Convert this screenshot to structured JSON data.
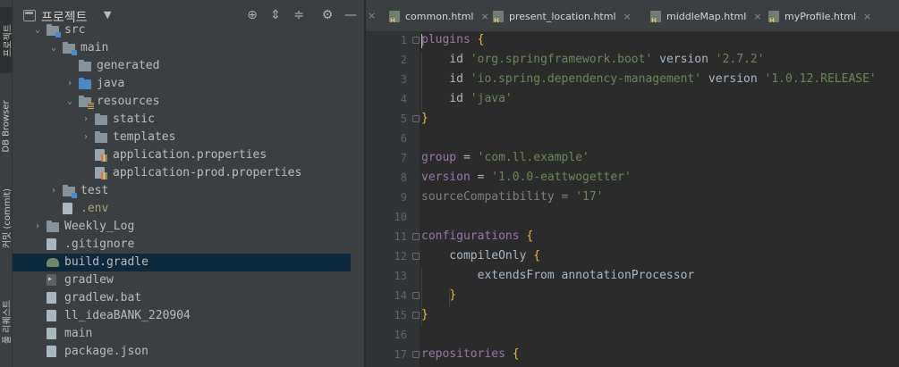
{
  "toolstrip": {
    "items": [
      {
        "label": "프로젝트"
      },
      {
        "label": "DB Browser"
      },
      {
        "label": "커밋 (commit)"
      },
      {
        "label": "풀 리퀘스트"
      }
    ]
  },
  "project_panel": {
    "title": "프로젝트",
    "dropdown": "▼",
    "header_icons": [
      "crosshair-icon",
      "expand-all-icon",
      "collapse-all-icon",
      "gear-icon",
      "minimize-icon"
    ]
  },
  "tree": [
    {
      "label": "src",
      "arrow": "⌄",
      "icon": "folder mod"
    },
    {
      "label": "main",
      "arrow": "⌄",
      "icon": "folder mod"
    },
    {
      "label": "generated",
      "arrow": "",
      "icon": "folder"
    },
    {
      "label": "java",
      "arrow": "›",
      "icon": "folder src"
    },
    {
      "label": "resources",
      "arrow": "⌄",
      "icon": "folder res"
    },
    {
      "label": "static",
      "arrow": "›",
      "icon": "folder"
    },
    {
      "label": "templates",
      "arrow": "›",
      "icon": "folder"
    },
    {
      "label": "application.properties",
      "arrow": "",
      "icon": "file props"
    },
    {
      "label": "application-prod.properties",
      "arrow": "",
      "icon": "file props"
    },
    {
      "label": "test",
      "arrow": "›",
      "icon": "folder mod"
    },
    {
      "label": ".env",
      "arrow": "",
      "icon": "file text",
      "color": "#a8a56f"
    },
    {
      "label": "Weekly_Log",
      "arrow": "›",
      "icon": "folder"
    },
    {
      "label": ".gitignore",
      "arrow": "",
      "icon": "file text"
    },
    {
      "label": "build.gradle",
      "arrow": "",
      "icon": "file gradle",
      "selected": true
    },
    {
      "label": "gradlew",
      "arrow": "",
      "icon": "file term"
    },
    {
      "label": "gradlew.bat",
      "arrow": "",
      "icon": "file text"
    },
    {
      "label": "ll_ideaBANK_220904",
      "arrow": "",
      "icon": "file text"
    },
    {
      "label": "main",
      "arrow": "",
      "icon": "file text"
    },
    {
      "label": "package.json",
      "arrow": "",
      "icon": "file text"
    }
  ],
  "tabs": [
    {
      "label": "common.html",
      "close": "×"
    },
    {
      "label": "present_location.html",
      "close": "×"
    },
    {
      "label": "middleMap.html",
      "close": "×"
    },
    {
      "label": "myProfile.html",
      "close": "×"
    }
  ],
  "tabbar": {
    "scroll_close": "×"
  },
  "editor": {
    "line_numbers": [
      "1",
      "2",
      "3",
      "4",
      "5",
      "6",
      "7",
      "8",
      "9",
      "10",
      "11",
      "12",
      "13",
      "14",
      "15",
      "16",
      "17"
    ],
    "lines": [
      [
        {
          "t": "plugins ",
          "c": "gr"
        },
        {
          "t": "{",
          "c": "brace"
        }
      ],
      [
        {
          "t": "    id ",
          "c": ""
        },
        {
          "t": "'org.springframework.boot'",
          "c": "str"
        },
        {
          "t": " version ",
          "c": ""
        },
        {
          "t": "'2.7.2'",
          "c": "str"
        }
      ],
      [
        {
          "t": "    id ",
          "c": ""
        },
        {
          "t": "'io.spring.dependency-management'",
          "c": "str"
        },
        {
          "t": " version ",
          "c": ""
        },
        {
          "t": "'1.0.12.RELEASE'",
          "c": "str"
        }
      ],
      [
        {
          "t": "    id ",
          "c": ""
        },
        {
          "t": "'java'",
          "c": "str"
        }
      ],
      [
        {
          "t": "}",
          "c": "brace"
        }
      ],
      [],
      [
        {
          "t": "group",
          "c": "gr"
        },
        {
          "t": " = ",
          "c": ""
        },
        {
          "t": "'com.ll.example'",
          "c": "str"
        }
      ],
      [
        {
          "t": "version",
          "c": "gr"
        },
        {
          "t": " = ",
          "c": ""
        },
        {
          "t": "'1.0.0-eattwogetter'",
          "c": "str"
        }
      ],
      [
        {
          "t": "sourceCompatibility",
          "c": "dim"
        },
        {
          "t": " = ",
          "c": "dim"
        },
        {
          "t": "'17'",
          "c": "str"
        }
      ],
      [],
      [
        {
          "t": "configurations ",
          "c": "gr"
        },
        {
          "t": "{",
          "c": "brace"
        }
      ],
      [
        {
          "t": "    compileOnly ",
          "c": ""
        },
        {
          "t": "{",
          "c": "brace"
        }
      ],
      [
        {
          "t": "        extendsFrom annotationProcessor",
          "c": ""
        }
      ],
      [
        {
          "t": "    }",
          "c": "brace"
        }
      ],
      [
        {
          "t": "}",
          "c": "brace"
        }
      ],
      [],
      [
        {
          "t": "repositories ",
          "c": "gr"
        },
        {
          "t": "{",
          "c": "brace"
        }
      ]
    ]
  }
}
